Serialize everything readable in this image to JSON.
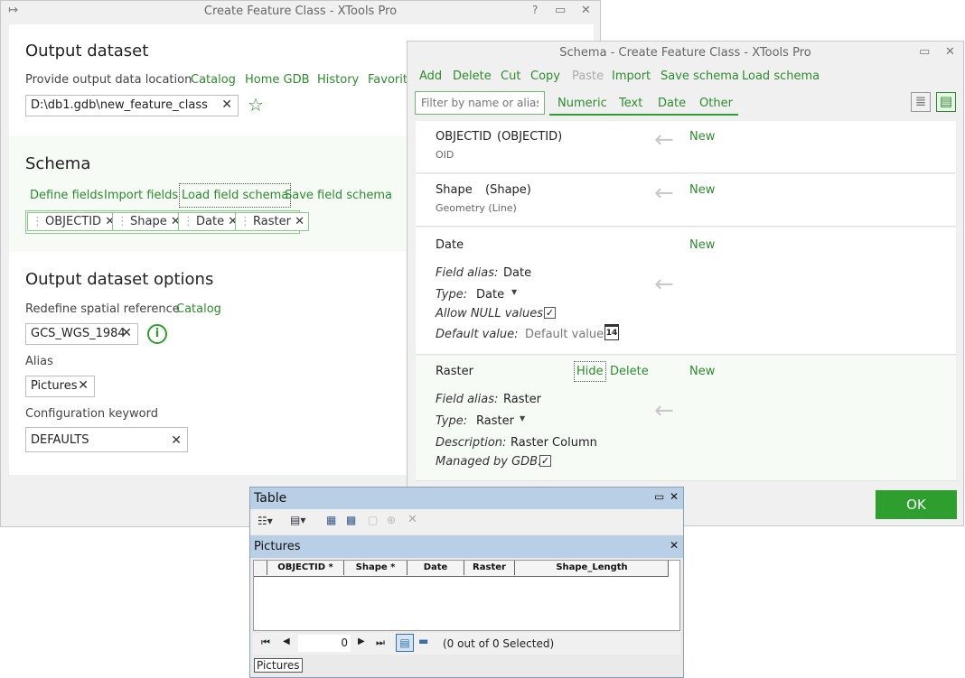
{
  "main": {
    "title": "Create Feature Class - XTools Pro",
    "help": "?",
    "output_dataset": {
      "heading": "Output dataset",
      "provide_label": "Provide output data location",
      "links": [
        "Catalog",
        "Home GDB",
        "History",
        "Favorite"
      ],
      "path": "D:\\db1.gdb\\new_feature_class"
    },
    "schema": {
      "heading": "Schema",
      "links": [
        "Define fields",
        "Import fields",
        "Load field schema",
        "Save field schema"
      ],
      "chips": [
        "OBJECTID",
        "Shape",
        "Date",
        "Raster"
      ]
    },
    "options": {
      "heading": "Output dataset options",
      "spatial_label": "Redefine spatial reference",
      "spatial_link": "Catalog",
      "spatial_value": "GCS_WGS_1984",
      "alias_label": "Alias",
      "alias_value": "Pictures",
      "config_label": "Configuration keyword",
      "config_value": "DEFAULTS"
    }
  },
  "schema_win": {
    "title": "Schema - Create Feature Class - XTools Pro",
    "toolbar": [
      "Add",
      "Delete",
      "Cut",
      "Copy",
      "Paste",
      "Import",
      "Save schema",
      "Load schema"
    ],
    "filter_placeholder": "Filter by name or alias",
    "filter_tabs": [
      "Numeric",
      "Text",
      "Date",
      "Other"
    ],
    "fields": [
      {
        "name": "OBJECTID",
        "alias": "(OBJECTID)",
        "type": "OID",
        "status": "New"
      },
      {
        "name": "Shape",
        "alias": "(Shape)",
        "type": "Geometry (Line)",
        "status": "New"
      },
      {
        "name": "Date",
        "status": "New",
        "field_alias_label": "Field alias:",
        "field_alias": "Date",
        "type_label": "Type:",
        "type": "Date",
        "null_label": "Allow NULL values:",
        "default_label": "Default value:",
        "default_placeholder": "Default value",
        "calendar_day": "14"
      },
      {
        "name": "Raster",
        "status": "New",
        "hide": "Hide",
        "delete": "Delete",
        "field_alias_label": "Field alias:",
        "field_alias": "Raster",
        "type_label": "Type:",
        "type": "Raster",
        "desc_label": "Description:",
        "desc": "Raster Column",
        "managed_label": "Managed by GDB:"
      }
    ],
    "ok": "OK"
  },
  "table_win": {
    "title": "Table",
    "layer": "Pictures",
    "columns": [
      "OBJECTID *",
      "Shape *",
      "Date",
      "Raster",
      "Shape_Length"
    ],
    "record": "0",
    "selected": "(0 out of 0 Selected)",
    "tab": "Pictures"
  }
}
